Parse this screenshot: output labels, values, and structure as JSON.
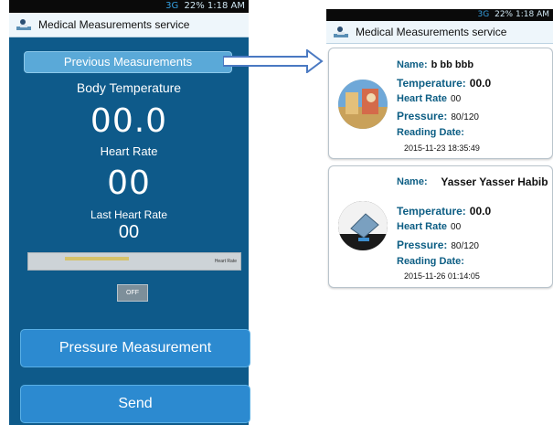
{
  "left_screen": {
    "status_bar": {
      "network": "3G",
      "battery": "22%",
      "time": "1:18 AM"
    },
    "app_title": "Medical Measurements service",
    "previous_button": "Previous Measurements",
    "body_temperature_label": "Body Temperature",
    "body_temperature_value": "00.0",
    "heart_rate_label": "Heart Rate",
    "heart_rate_value": "00",
    "last_heart_rate_label": "Last Heart Rate",
    "last_heart_rate_value": "00",
    "progress_label": "Heart Rate",
    "toggle_label": "OFF",
    "pressure_button": "Pressure Measurement",
    "send_button": "Send"
  },
  "right_screen": {
    "status_bar": {
      "network": "3G",
      "battery": "22%",
      "time": "1:18 AM"
    },
    "app_title": "Medical Measurements service",
    "labels": {
      "name": "Name:",
      "temperature": "Temperature:",
      "heart_rate": "Heart Rate",
      "pressure": "Pressure:",
      "reading_date": "Reading Date:"
    },
    "records": [
      {
        "name": "b bb bbb",
        "temperature": "00.0",
        "heart_rate": "00",
        "pressure": "80/120",
        "reading_date": "2015-11-23 18:35:49"
      },
      {
        "name": "Yasser Yasser Habib",
        "temperature": "00.0",
        "heart_rate": "00",
        "pressure": "80/120",
        "reading_date": "2015-11-26 01:14:05"
      }
    ]
  },
  "colors": {
    "panel_blue": "#0e5a8a",
    "button_blue": "#2c8ad0",
    "label_teal": "#0d5e84",
    "arrow_blue": "#4a79c2"
  },
  "icons": [
    "medical-app-icon",
    "arrow-right-icon",
    "avatar-photo-1",
    "avatar-photo-2"
  ]
}
